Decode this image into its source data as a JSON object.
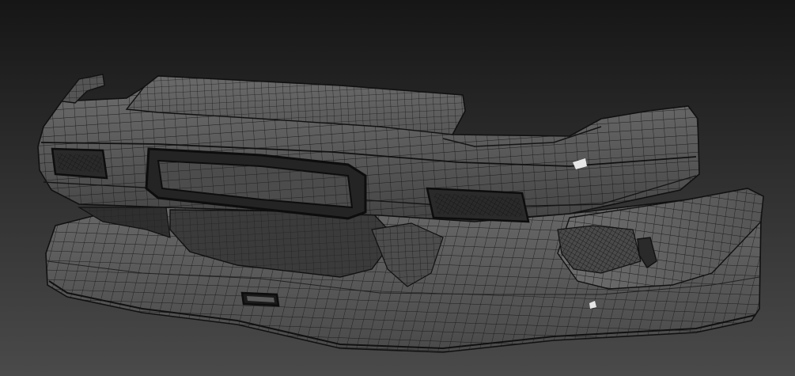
{
  "viewport": {
    "content": "bumper-wireframe-model",
    "background_top": "#161616",
    "background_bottom": "#4a4a4a",
    "mesh_fill": "#5e5e5e",
    "mesh_fill_light": "#747474",
    "mesh_fill_dark": "#3a3a3a",
    "wire_color": "#1b1b1b",
    "highlight": "#e6e6e6"
  }
}
